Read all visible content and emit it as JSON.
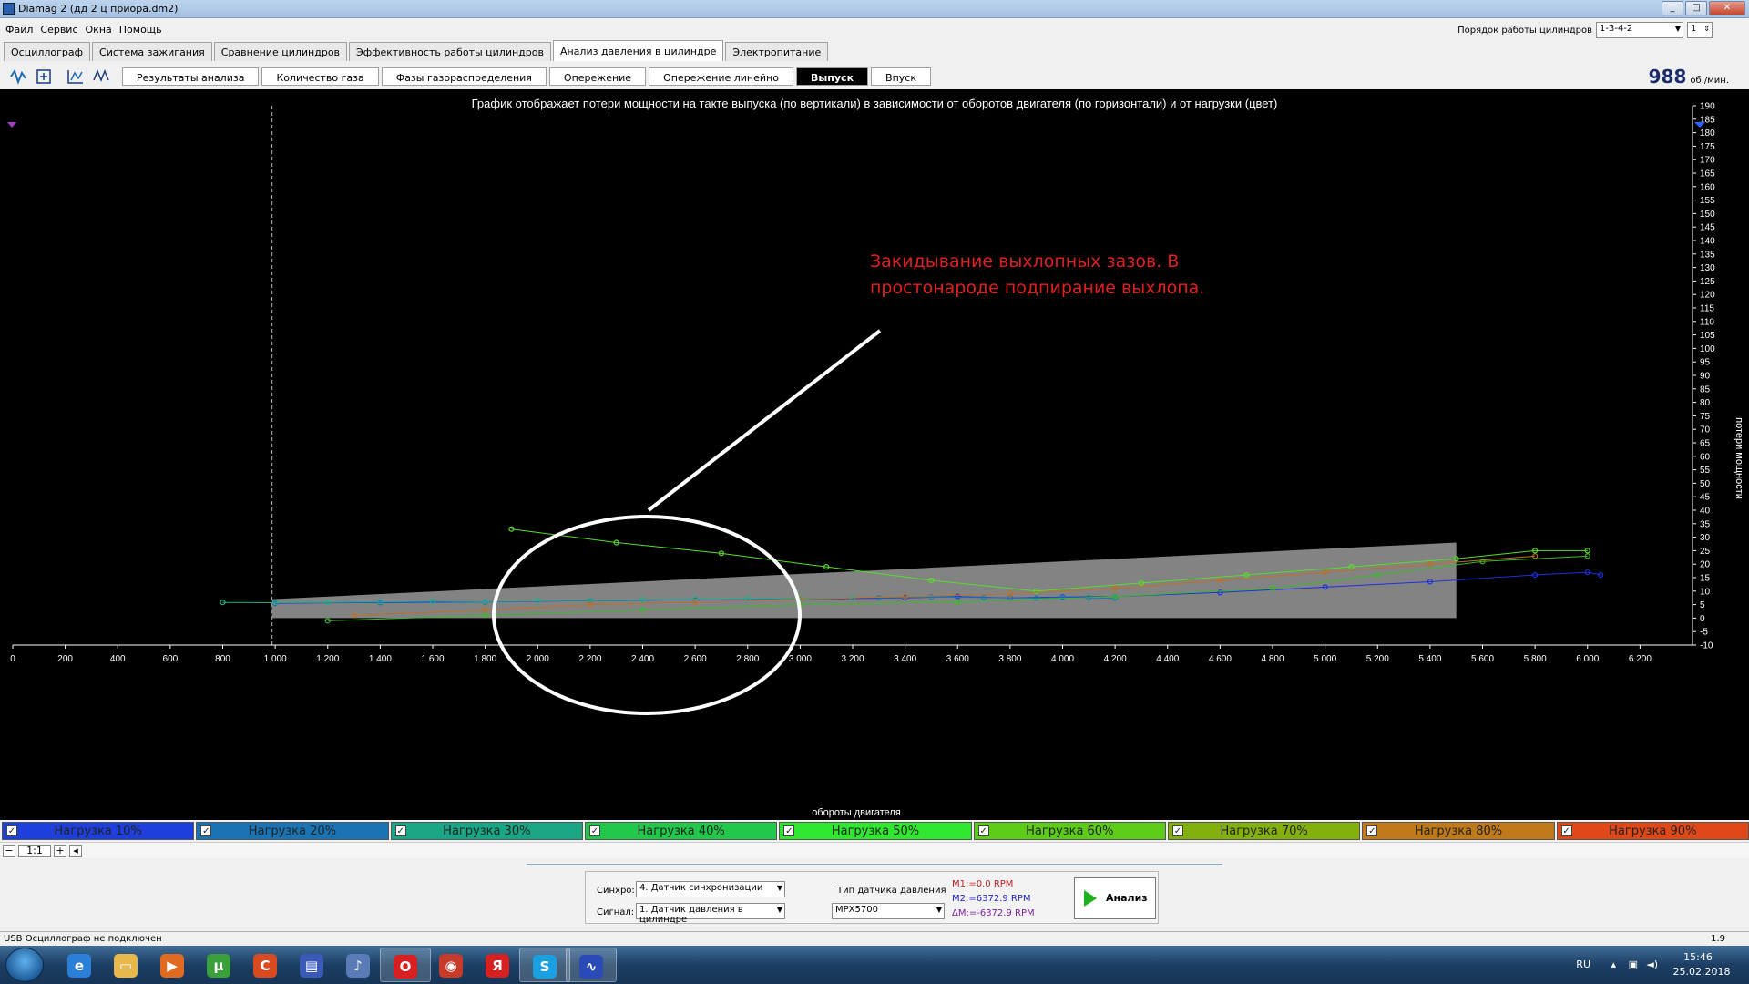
{
  "window": {
    "title": "Diamag 2 (дд 2 ц приора.dm2)",
    "buttons": [
      "_",
      "□",
      "✕"
    ]
  },
  "menu": [
    "Файл",
    "Сервис",
    "Окна",
    "Помощь"
  ],
  "cylinder_order": {
    "label": "Порядок работы цилиндров",
    "value": "1-3-4-2",
    "cylinder": "1"
  },
  "main_tabs": [
    {
      "label": "Осциллограф",
      "active": false
    },
    {
      "label": "Система зажигания",
      "active": false
    },
    {
      "label": "Сравнение цилиндров",
      "active": false
    },
    {
      "label": "Эффективность работы цилиндров",
      "active": false
    },
    {
      "label": "Анализ давления в цилиндре",
      "active": true
    },
    {
      "label": "Электропитание",
      "active": false
    }
  ],
  "sub_tabs": [
    {
      "label": "Результаты анализа",
      "active": false
    },
    {
      "label": "Количество газа",
      "active": false
    },
    {
      "label": "Фазы газораспределения",
      "active": false
    },
    {
      "label": "Опережение",
      "active": false
    },
    {
      "label": "Опережение линейно",
      "active": false
    },
    {
      "label": "Выпуск",
      "active": true
    },
    {
      "label": "Впуск",
      "active": false
    }
  ],
  "toolbar_icons": [
    "waveform-icon",
    "fit-icon",
    "zoom-icon",
    "auto-scale-icon"
  ],
  "rpm": {
    "value": "988",
    "unit": "об./мин."
  },
  "chart_data": {
    "type": "scatter",
    "title": "График отображает потери мощности на такте выпуска (по вертикали) в зависимости от оборотов двигателя (по горизонтали) и от нагрузки (цвет)",
    "xlabel": "обороты двигателя",
    "ylabel": "потери мощности",
    "xlim": [
      0,
      6400
    ],
    "ylim": [
      -10,
      190
    ],
    "xticks": [
      "0",
      "200",
      "400",
      "600",
      "800",
      "1 000",
      "1 200",
      "1 400",
      "1 600",
      "1 800",
      "2 000",
      "2 200",
      "2 400",
      "2 600",
      "2 800",
      "3 000",
      "3 200",
      "3 400",
      "3 600",
      "3 800",
      "4 000",
      "4 200",
      "4 400",
      "4 600",
      "4 800",
      "5 000",
      "5 200",
      "5 400",
      "5 600",
      "5 800",
      "6 000",
      "6 200"
    ],
    "yticks": [
      -10,
      -5,
      0,
      5,
      10,
      15,
      20,
      25,
      30,
      35,
      40,
      45,
      50,
      55,
      60,
      65,
      70,
      75,
      80,
      85,
      90,
      95,
      100,
      105,
      110,
      115,
      120,
      125,
      130,
      135,
      140,
      145,
      150,
      155,
      160,
      165,
      170,
      175,
      180,
      185,
      190
    ],
    "cursor_x": 988,
    "reference_band": {
      "x": [
        988,
        5500
      ],
      "y_bottom": [
        0,
        0
      ],
      "y_top": [
        7,
        28
      ],
      "color": "#8a8a8a"
    },
    "series": [
      {
        "name": "Нагрузка 10%",
        "color": "#1a2fe0",
        "x": [
          1000,
          1400,
          1800,
          2200,
          2600,
          3000,
          3400,
          3600,
          3800,
          4000,
          4200,
          4600,
          5000,
          5400,
          5800,
          6000,
          6050
        ],
        "y": [
          5.5,
          5.8,
          6,
          6.5,
          6.8,
          7,
          7.5,
          8,
          7.5,
          7.8,
          8,
          9.5,
          11.5,
          13.5,
          16,
          17,
          16
        ]
      },
      {
        "name": "Нагрузка 20%",
        "color": "#1a7ab0",
        "x": [
          3300,
          3500,
          3700,
          3800,
          3900,
          4000,
          4100,
          4200
        ],
        "y": [
          7.5,
          7.8,
          7.6,
          7.5,
          7.4,
          7.6,
          7.5,
          7.4
        ]
      },
      {
        "name": "Нагрузка 30%",
        "color": "#1ab08a",
        "x": [
          800,
          1000,
          1200,
          1400,
          1600,
          1800,
          2000,
          2200,
          2400,
          2600,
          2800,
          3000,
          3200
        ],
        "y": [
          5.8,
          5.7,
          5.8,
          6,
          6.2,
          6.1,
          6.4,
          6.6,
          6.8,
          7,
          7.1,
          7.3,
          7.5
        ]
      },
      {
        "name": "Нагрузка 40%",
        "color": "#3aba2a",
        "x": [
          1200,
          1800,
          2400,
          3000,
          3600,
          4200,
          4800,
          5200,
          5600,
          6000
        ],
        "y": [
          -1,
          1,
          3,
          5,
          6,
          8,
          11,
          16,
          21,
          23
        ]
      },
      {
        "name": "Нагрузка 50%",
        "color": "#5adc2a",
        "x": [
          1900,
          2300,
          2700,
          3100,
          3500,
          3900,
          4300,
          4700,
          5100,
          5500,
          5800,
          6000
        ],
        "y": [
          33,
          28,
          24,
          19,
          14,
          10,
          13,
          16,
          19,
          22,
          25,
          25
        ]
      },
      {
        "name": "Нагрузка 60%",
        "color": "#6aaa1a",
        "x": [],
        "y": []
      },
      {
        "name": "Нагрузка 70%",
        "color": "#8a9a10",
        "x": [],
        "y": []
      },
      {
        "name": "Нагрузка 80%",
        "color": "#c07020",
        "x": [
          1300,
          1800,
          2200,
          2600,
          3000,
          3400,
          3800,
          4200,
          4600,
          5000,
          5400,
          5800
        ],
        "y": [
          1,
          3,
          5,
          6,
          7,
          8,
          9,
          11,
          14,
          17,
          20,
          23
        ]
      },
      {
        "name": "Нагрузка 90%",
        "color": "#d04020",
        "x": [],
        "y": []
      }
    ],
    "annotation": {
      "text": "Закидывание выхлопных зазов. В простонароде подпирание выхлопа.",
      "color": "#e02020"
    }
  },
  "legend": [
    {
      "label": "Нагрузка 10%",
      "color": "#1e3fdc",
      "checked": true
    },
    {
      "label": "Нагрузка 20%",
      "color": "#1a74b4",
      "checked": true
    },
    {
      "label": "Нагрузка 30%",
      "color": "#19a684",
      "checked": true
    },
    {
      "label": "Нагрузка 40%",
      "color": "#22c84a",
      "checked": true
    },
    {
      "label": "Нагрузка 50%",
      "color": "#30e830",
      "checked": true
    },
    {
      "label": "Нагрузка 60%",
      "color": "#5ccc18",
      "checked": true
    },
    {
      "label": "Нагрузка 70%",
      "color": "#84b00e",
      "checked": true
    },
    {
      "label": "Нагрузка 80%",
      "color": "#c07a1a",
      "checked": true
    },
    {
      "label": "Нагрузка 90%",
      "color": "#e04818",
      "checked": true
    }
  ],
  "scale": {
    "zoom": "1:1"
  },
  "controls": {
    "sync_label": "Синхро:",
    "sync_value": "4.  Датчик синхронизации",
    "signal_label": "Сигнал:",
    "signal_value": "1.  Датчик давления в цилиндре",
    "sensor_type_label": "Тип датчика давления",
    "sensor_type_value": "MPX5700",
    "m1": "M1:=0.0 RPM",
    "m2": "M2:=6372.9 RPM",
    "dm": "ΔM:=-6372.9 RPM",
    "analyze_label": "Анализ"
  },
  "status": {
    "text": "USB Осциллограф не подключен",
    "right": "1.9"
  },
  "taskbar": {
    "apps": [
      "ie-icon",
      "explorer-icon",
      "media-player-icon",
      "utorrent-icon",
      "ccleaner-icon",
      "save-icon",
      "audio-icon",
      "opera-icon",
      "chrome-icon",
      "yandex-icon",
      "skype-icon",
      "diamag-icon"
    ],
    "lang": "RU",
    "time": "15:46",
    "date": "25.02.2018"
  }
}
